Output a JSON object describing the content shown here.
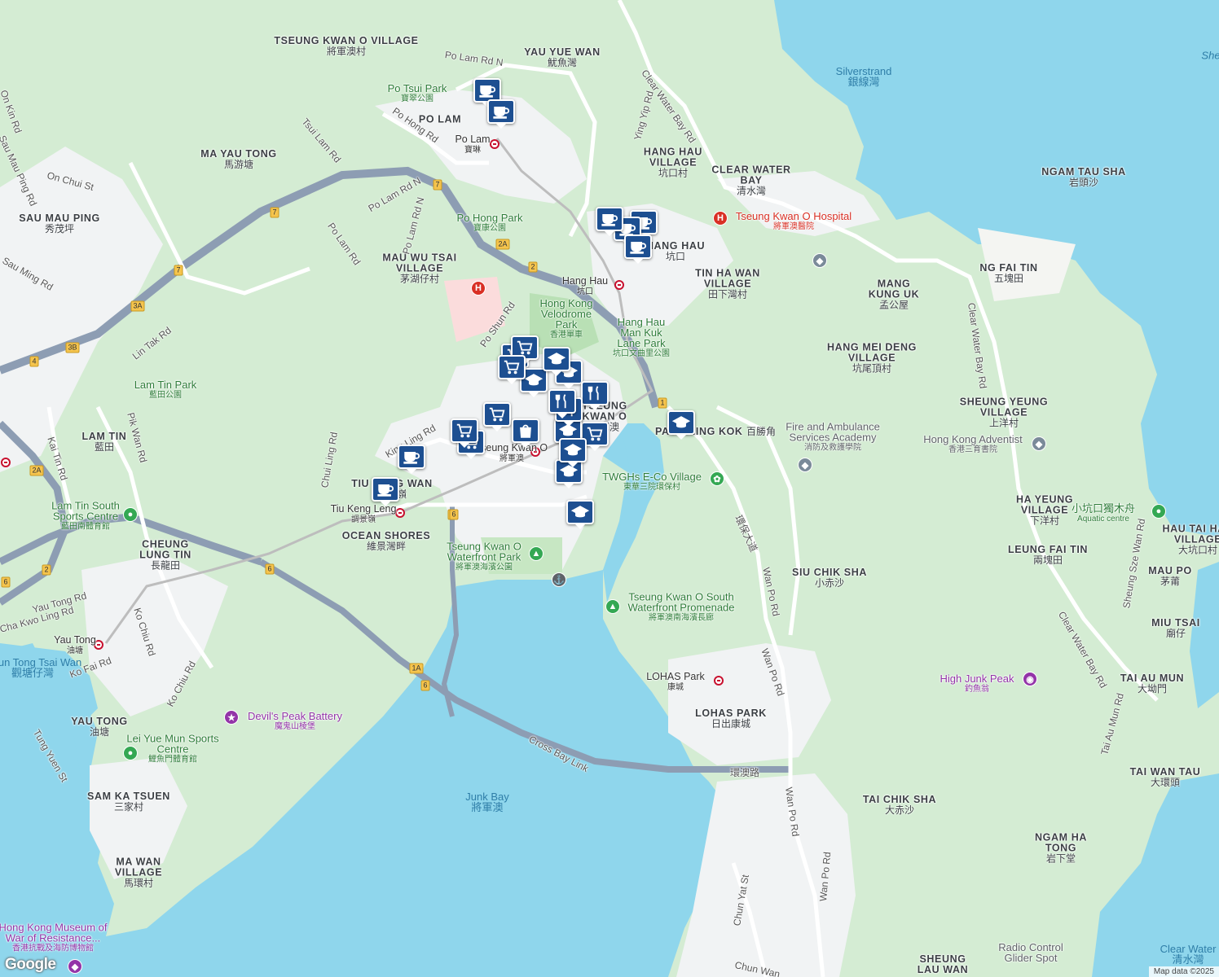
{
  "map": {
    "attribution": "Map data ©2025",
    "logo": "Google",
    "colors": {
      "land": "#d4ecd3",
      "water": "#8fd6ec",
      "urban": "#f1f3f4",
      "park": "#b9e0b5",
      "road": "#ffffff",
      "highway": "#8d9db3",
      "pin": "#1d4f91"
    }
  },
  "places": [
    {
      "en": "TSEUNG KWAN O VILLAGE",
      "zh": "將軍澳村"
    },
    {
      "en": "YAU YUE WAN",
      "zh": "魷魚灣"
    },
    {
      "en": "PO LAM",
      "zh": ""
    },
    {
      "en": "MA YAU TONG",
      "zh": "馬游塘"
    },
    {
      "en": "SAU MAU PING",
      "zh": "秀茂坪"
    },
    {
      "en": "MAU WU TSAI VILLAGE",
      "zh": "茅湖仔村"
    },
    {
      "en": "HANG HAU VILLAGE",
      "zh": "坑口村"
    },
    {
      "en": "CLEAR WATER BAY",
      "zh": "清水灣"
    },
    {
      "en": "NGAM TAU SHA",
      "zh": "岩頭沙"
    },
    {
      "en": "NG FAI TIN",
      "zh": "五塊田"
    },
    {
      "en": "MANG KUNG UK",
      "zh": "孟公屋"
    },
    {
      "en": "HANG HAU",
      "zh": "坑口"
    },
    {
      "en": "TIN HA WAN VILLAGE",
      "zh": "田下灣村"
    },
    {
      "en": "HANG MEI DENG VILLAGE",
      "zh": "坑尾頂村"
    },
    {
      "en": "SHEUNG YEUNG VILLAGE",
      "zh": "上洋村"
    },
    {
      "en": "PAK SHING KOK",
      "zh": "百勝角"
    },
    {
      "en": "LAM TIN",
      "zh": "藍田"
    },
    {
      "en": "TIU KENG WAN",
      "zh": "調景嶺"
    },
    {
      "en": "OCEAN SHORES",
      "zh": "維景灣畔"
    },
    {
      "en": "CHEUNG LUNG TIN",
      "zh": "長龍田"
    },
    {
      "en": "HA YEUNG VILLAGE",
      "zh": "下洋村"
    },
    {
      "en": "LEUNG FAI TIN",
      "zh": "兩塊田"
    },
    {
      "en": "HAU TAI HAU VILLAGE",
      "zh": "大坑口村"
    },
    {
      "en": "MAU PO",
      "zh": "茅莆"
    },
    {
      "en": "MIU TSAI",
      "zh": "廟仔"
    },
    {
      "en": "SIU CHIK SHA",
      "zh": "小赤沙"
    },
    {
      "en": "TAI AU MUN",
      "zh": "大坳門"
    },
    {
      "en": "LOHAS PARK",
      "zh": "日出康城"
    },
    {
      "en": "YAU TONG",
      "zh": "油塘"
    },
    {
      "en": "SAM KA TSUEN",
      "zh": "三家村"
    },
    {
      "en": "MA WAN VILLAGE",
      "zh": "馬環村"
    },
    {
      "en": "TAI CHIK SHA",
      "zh": "大赤沙"
    },
    {
      "en": "TAI WAN TAU",
      "zh": "大環頭"
    },
    {
      "en": "NGAM HA TONG",
      "zh": "岩下堂"
    },
    {
      "en": "SHEUNG LAU WAN",
      "zh": ""
    },
    {
      "en": "TSEUNG KWAN O",
      "zh": "將軍澳"
    }
  ],
  "parks": [
    {
      "en": "Po Tsui Park",
      "zh": "寶翠公園"
    },
    {
      "en": "Po Hong Park",
      "zh": "寶康公園"
    },
    {
      "en": "Hong Kong Velodrome Park",
      "zh": "香港單車"
    },
    {
      "en": "Hang Hau Man Kuk Lane Park",
      "zh": "坑口文曲里公園"
    },
    {
      "en": "Lam Tin Park",
      "zh": "藍田公園"
    },
    {
      "en": "Lam Tin South Sports Centre",
      "zh": "藍田南體育館"
    },
    {
      "en": "Tseung Kwan O Waterfront Park",
      "zh": "將軍澳海濱公園"
    },
    {
      "en": "TWGHs E-Co Village",
      "zh": "東華三院環保村"
    },
    {
      "en": "Tseung Kwan O South Waterfront Promenade",
      "zh": "將軍澳南海濱長廊"
    },
    {
      "en": "Lei Yue Mun Sports Centre",
      "zh": "鯉魚門體育館"
    },
    {
      "en": "Hong Kong Adventist",
      "zh": "香港三育書院"
    },
    {
      "en": "Fire and Ambulance Services Academy",
      "zh": "消防及救護學院"
    },
    {
      "en": "小坑口獨木舟",
      "zh": "Aquatic centre"
    }
  ],
  "water": [
    {
      "en": "Silverstrand",
      "zh": "銀線灣"
    },
    {
      "en": "Junk Bay",
      "zh": "將軍澳"
    },
    {
      "en": "Kwun Tong Tsai Wan",
      "zh": "觀塘仔灣"
    },
    {
      "en": "Clear Water",
      "zh": "清水灣"
    },
    {
      "en": "She",
      "zh": ""
    }
  ],
  "special": [
    {
      "en": "Tseung Kwan O Hospital",
      "zh": "將軍澳醫院",
      "kind": "hosp"
    },
    {
      "en": "Devil's Peak Battery",
      "zh": "魔鬼山棱堡",
      "kind": "purple"
    },
    {
      "en": "High Junk Peak",
      "zh": "釣魚翁",
      "kind": "purple"
    },
    {
      "en": "Radio Control Glider Spot",
      "zh": "",
      "kind": "poi"
    },
    {
      "en": "Hong Kong Museum of War of Resistance...",
      "zh": "香港抗戰及海防博物館",
      "kind": "purple"
    }
  ],
  "stations": [
    {
      "en": "Po Lam",
      "zh": "寶琳"
    },
    {
      "en": "Hang Hau",
      "zh": "坑口"
    },
    {
      "en": "Tiu Keng Leng",
      "zh": "調景嶺"
    },
    {
      "en": "Tseung Kwan O",
      "zh": "將軍澳"
    },
    {
      "en": "LOHAS Park",
      "zh": "康城"
    },
    {
      "en": "Yau Tong",
      "zh": "油塘"
    },
    {
      "en": "Lam Tin",
      "zh": ""
    }
  ],
  "roads": [
    "Po Lam Rd N",
    "Clear Water Bay Rd",
    "Ying Yip Rd",
    "Po Hong Rd",
    "Tsui Lam Rd",
    "On Chui St",
    "Po Lam Rd N",
    "Po Lam Rd",
    "Po Lam Rd N",
    "Po Shun Rd",
    "Lin Tak Rd",
    "Pik Wan Rd",
    "Kai Tin Rd",
    "King Ling Rd",
    "Chui Ling Rd",
    "Ko Chiu Rd",
    "Ko Chiu Rd",
    "Ko Fai Rd",
    "Tung Yuen St",
    "Yau Tong Rd",
    "Cha Kwo Ling Rd",
    "Cross Bay Link",
    "環澳路",
    "Wan Po Rd",
    "Wan Po Rd",
    "Wan Po Rd",
    "Wan Po Rd",
    "Clear Water Bay Rd",
    "Clear Water Bay Rd",
    "環保大道",
    "Chun Yat St",
    "Chun Wan",
    "Tai Au Mun Rd",
    "Sheung Sze Wan Rd",
    "Sau Ming Rd",
    "Sau Mau Ping Rd",
    "On Kin Rd"
  ],
  "shields": [
    "7",
    "7",
    "7",
    "3A",
    "3B",
    "4",
    "2A",
    "2",
    "2",
    "1",
    "6",
    "6",
    "1A",
    "6",
    "2A",
    "2",
    "6"
  ],
  "pins": [
    {
      "type": "cafe"
    },
    {
      "type": "cafe"
    },
    {
      "type": "cafe"
    },
    {
      "type": "cafe"
    },
    {
      "type": "cafe"
    },
    {
      "type": "cafe"
    },
    {
      "type": "cafe"
    },
    {
      "type": "shopping"
    },
    {
      "type": "shopping"
    },
    {
      "type": "shopping"
    },
    {
      "type": "shopping"
    },
    {
      "type": "shopping"
    },
    {
      "type": "shopping"
    },
    {
      "type": "school"
    },
    {
      "type": "school"
    },
    {
      "type": "school"
    },
    {
      "type": "school"
    },
    {
      "type": "school"
    },
    {
      "type": "school"
    },
    {
      "type": "school"
    },
    {
      "type": "restaurant"
    },
    {
      "type": "restaurant"
    },
    {
      "type": "restaurant"
    },
    {
      "type": "bag"
    },
    {
      "type": "school"
    },
    {
      "type": "shopping"
    },
    {
      "type": "cafe"
    }
  ]
}
